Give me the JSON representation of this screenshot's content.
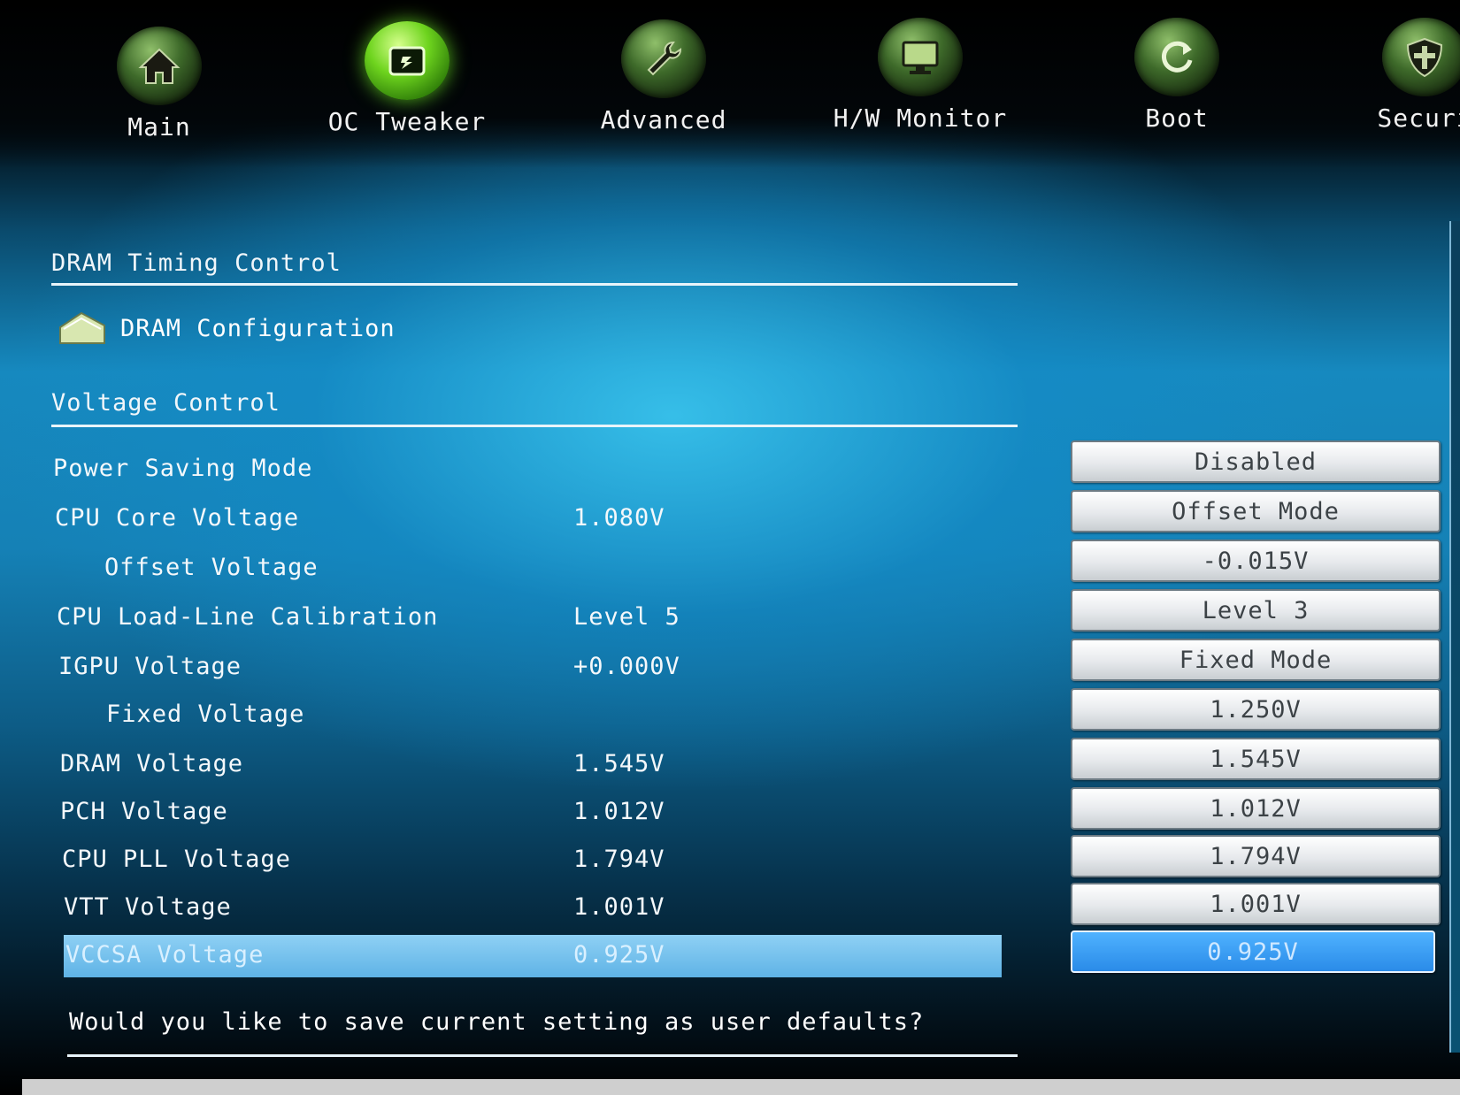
{
  "nav": {
    "tabs": [
      {
        "label": "Main",
        "icon": "home-icon"
      },
      {
        "label": "OC Tweaker",
        "icon": "oc-tweaker-icon"
      },
      {
        "label": "Advanced",
        "icon": "wrench-icon"
      },
      {
        "label": "H/W Monitor",
        "icon": "monitor-icon"
      },
      {
        "label": "Boot",
        "icon": "refresh-icon"
      },
      {
        "label": "Securi",
        "icon": "shield-icon"
      }
    ],
    "active_tab": "OC Tweaker"
  },
  "sections": {
    "dram_timing": "DRAM Timing Control",
    "dram_config": "DRAM Configuration",
    "voltage_control": "Voltage Control"
  },
  "rows": [
    {
      "label": "Power Saving Mode",
      "value": "",
      "option": "Disabled"
    },
    {
      "label": "CPU Core Voltage",
      "value": "1.080V",
      "option": "Offset Mode"
    },
    {
      "label": "Offset Voltage",
      "value": "",
      "option": "-0.015V"
    },
    {
      "label": "CPU Load-Line Calibration",
      "value": "Level 5",
      "option": "Level 3"
    },
    {
      "label": "IGPU Voltage",
      "value": "+0.000V",
      "option": "Fixed Mode"
    },
    {
      "label": "Fixed Voltage",
      "value": "",
      "option": "1.250V"
    },
    {
      "label": "DRAM Voltage",
      "value": "1.545V",
      "option": "1.545V"
    },
    {
      "label": "PCH Voltage",
      "value": "1.012V",
      "option": "1.012V"
    },
    {
      "label": "CPU PLL Voltage",
      "value": "1.794V",
      "option": "1.794V"
    },
    {
      "label": "VTT Voltage",
      "value": "1.001V",
      "option": "1.001V"
    },
    {
      "label": "VCCSA Voltage",
      "value": "0.925V",
      "option": "0.925V"
    }
  ],
  "selected_row": "VCCSA Voltage",
  "save_prompt": "Would you like to save current setting as user defaults?",
  "colors": {
    "highlight": "#5fb3e6",
    "active_icon": "#6ed41e"
  }
}
